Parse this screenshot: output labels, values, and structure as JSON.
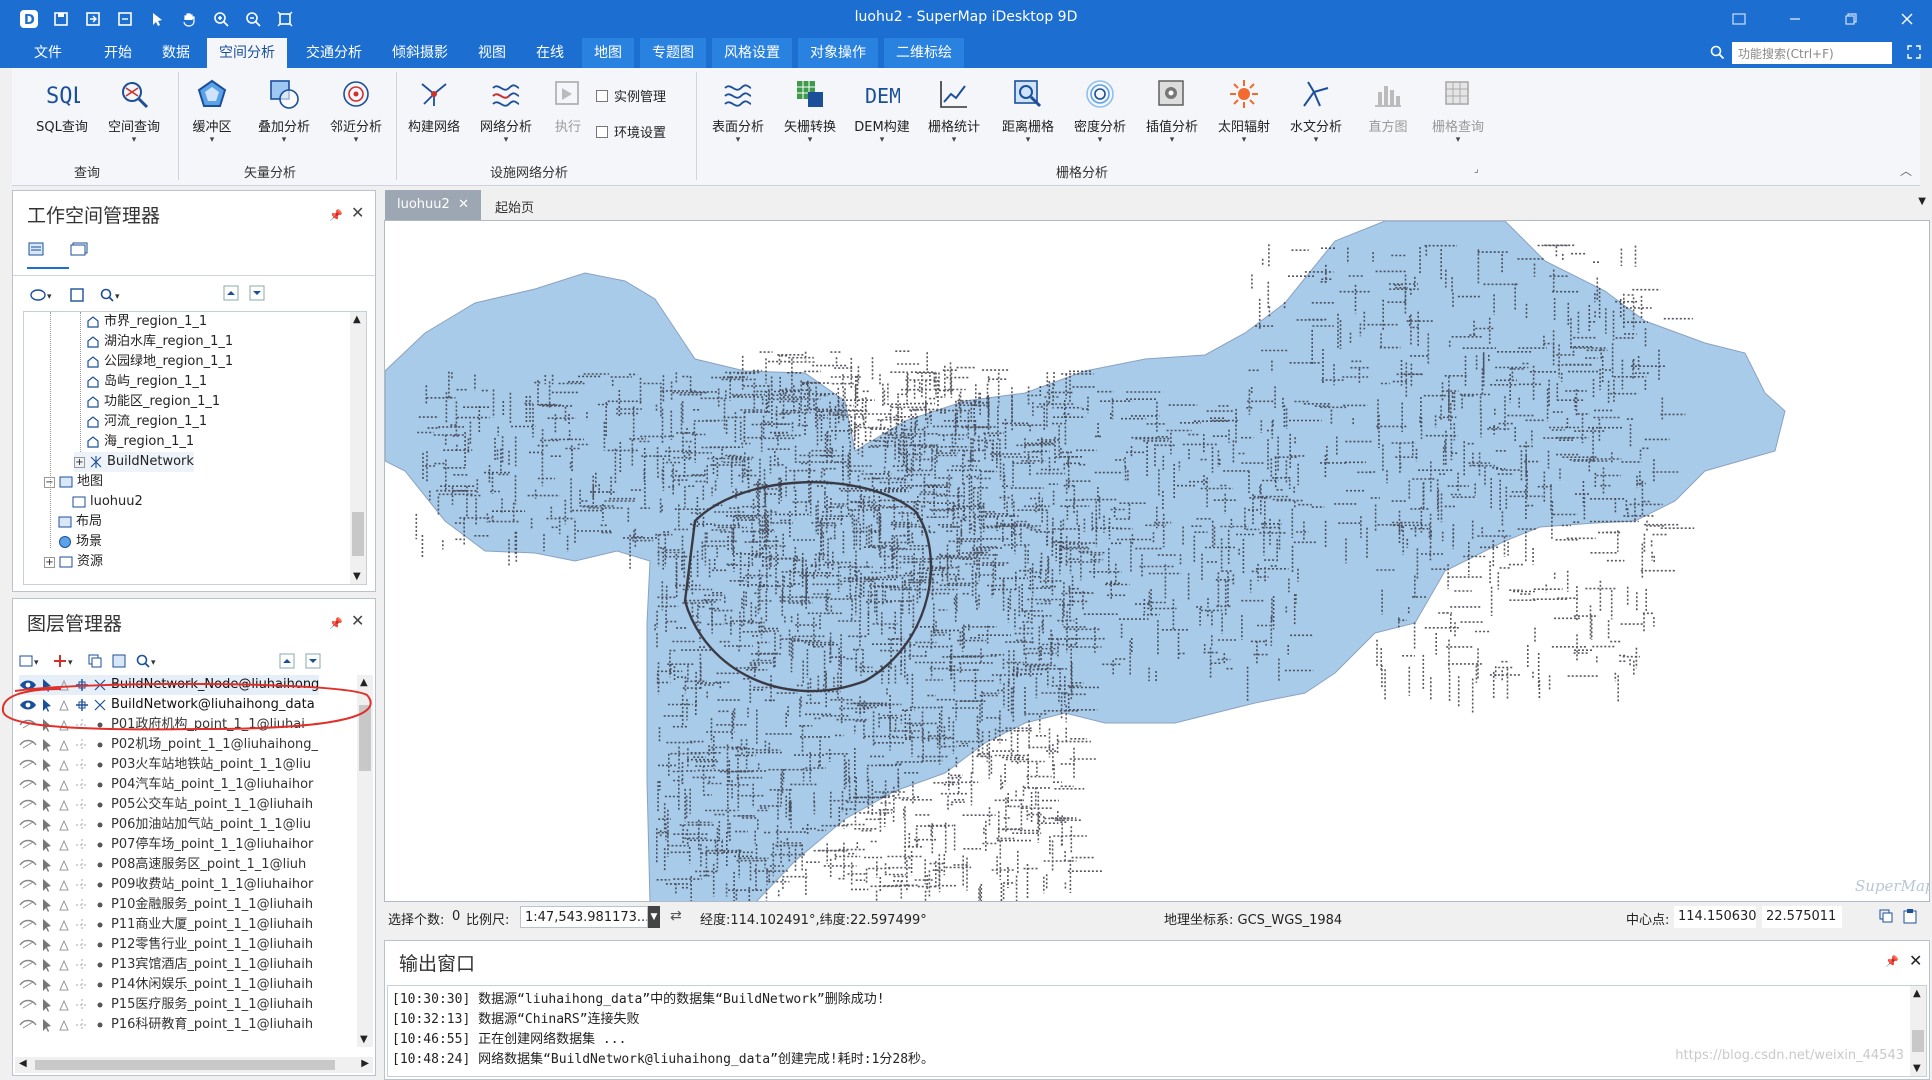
{
  "window": {
    "title": "luohu2 - SuperMap iDesktop 9D"
  },
  "menu": {
    "tabs": [
      "文件",
      "开始",
      "数据",
      "空间分析",
      "交通分析",
      "倾斜摄影",
      "视图",
      "在线",
      "地图",
      "专题图",
      "风格设置",
      "对象操作",
      "二维标绘"
    ],
    "active_tab": "空间分析",
    "search_placeholder": "功能搜索(Ctrl+F)"
  },
  "ribbon": {
    "query": {
      "sql": "SQL查询",
      "spatial": "空间查询",
      "group": "查询"
    },
    "vector": {
      "buffer": "缓冲区",
      "overlay": "叠加分析",
      "proximity": "邻近分析",
      "group": "矢量分析"
    },
    "network": {
      "build": "构建网络",
      "analysis": "网络分析",
      "run": "执行",
      "instance": "实例管理",
      "env": "环境设置",
      "group": "设施网络分析"
    },
    "raster": {
      "surface": "表面分析",
      "convert": "矢栅转换",
      "dem": "DEM构建",
      "stats": "栅格统计",
      "distance": "距离栅格",
      "density": "密度分析",
      "interp": "插值分析",
      "solar": "太阳辐射",
      "hydro": "水文分析",
      "hist": "直方图",
      "rquery": "栅格查询",
      "group": "栅格分析"
    }
  },
  "workspace": {
    "title": "工作空间管理器",
    "items": [
      "市界_region_1_1",
      "湖泊水库_region_1_1",
      "公园绿地_region_1_1",
      "岛屿_region_1_1",
      "功能区_region_1_1",
      "河流_region_1_1",
      "海_region_1_1",
      "BuildNetwork"
    ],
    "map_node": "地图",
    "map_child": "luohuu2",
    "layout_node": "布局",
    "scene_node": "场景",
    "resource_node": "资源"
  },
  "layers": {
    "title": "图层管理器",
    "items": [
      "BuildNetwork_Node@liuhaihong",
      "BuildNetwork@liuhaihong_data",
      "P01政府机构_point_1_1@liuhai",
      "P02机场_point_1_1@liuhaihong_",
      "P03火车站地铁站_point_1_1@liu",
      "P04汽车站_point_1_1@liuhaihor",
      "P05公交车站_point_1_1@liuhaih",
      "P06加油站加气站_point_1_1@liu",
      "P07停车场_point_1_1@liuhaihor",
      "P08高速服务区_point_1_1@liuh",
      "P09收费站_point_1_1@liuhaihor",
      "P10金融服务_point_1_1@liuhaih",
      "P11商业大厦_point_1_1@liuhaih",
      "P12零售行业_point_1_1@liuhaih",
      "P13宾馆酒店_point_1_1@liuhaih",
      "P14休闲娱乐_point_1_1@liuhaih",
      "P15医疗服务_point_1_1@liuhaih",
      "P16科研教育_point_1_1@liuhaih"
    ]
  },
  "doc_tabs": {
    "active": "luohuu2",
    "other": "起始页"
  },
  "status": {
    "selected_label": "选择个数:",
    "selected_value": "0",
    "scale_label": "比例尺:",
    "scale_value": "1:47,543.981173...",
    "coords": "经度:114.102491°,纬度:22.597499°",
    "crs": "地理坐标系: GCS_WGS_1984",
    "center_label": "中心点:",
    "center_x": "114.150630",
    "center_y": "22.575011"
  },
  "output": {
    "title": "输出窗口",
    "lines": [
      "[10:30:30] 数据源“liuhaihong_data”中的数据集“BuildNetwork”删除成功!",
      "[10:32:13] 数据源“ChinaRS”连接失败",
      "[10:46:55] 正在创建网络数据集 ...",
      "[10:48:24] 网络数据集“BuildNetwork@liuhaihong_data”创建完成!耗时:1分28秒。"
    ],
    "watermark": "https://blog.csdn.net/weixin_44543"
  },
  "map": {
    "watermark": "SuperMap",
    "region_fill": "#a8cbe9",
    "network_color": "#3a3a44"
  },
  "colors": {
    "titlebar": "#1c6fd1",
    "annotation": "#e0302a"
  }
}
